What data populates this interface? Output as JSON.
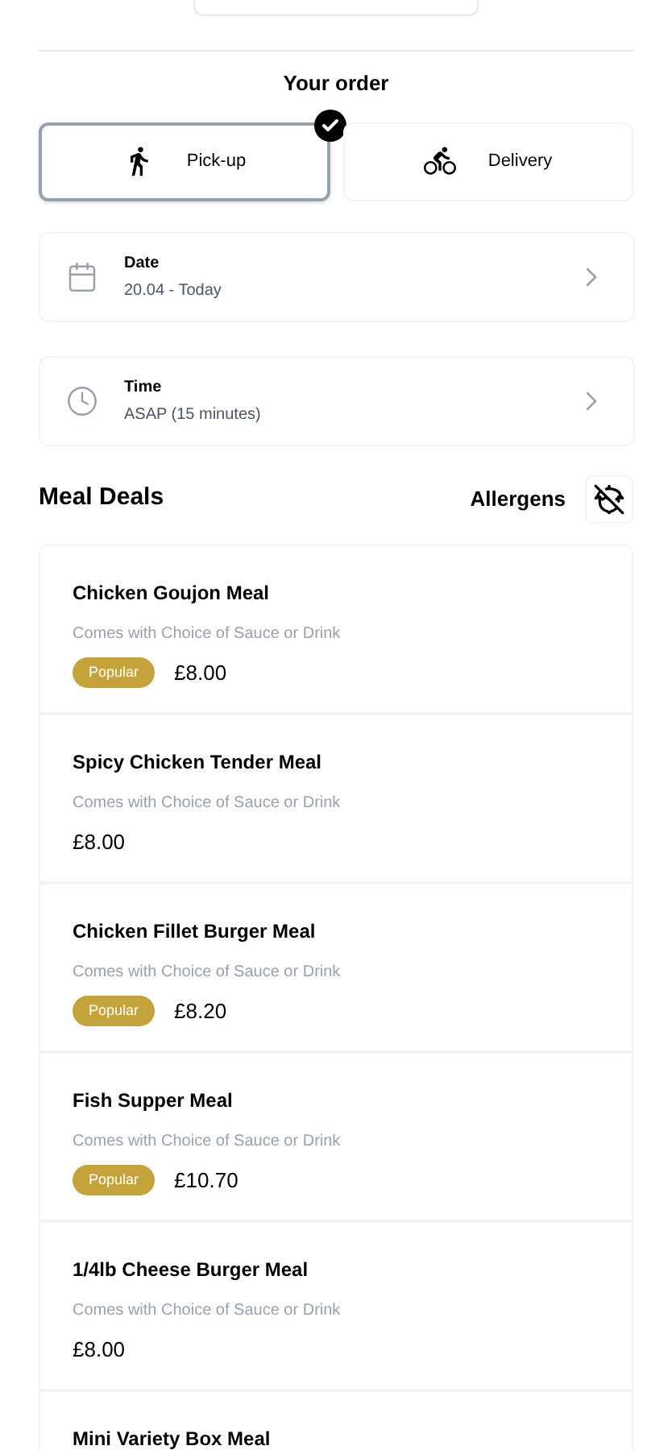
{
  "order": {
    "title": "Your order",
    "modes": [
      {
        "kind": "pickup",
        "label": "Pick-up",
        "selected": true
      },
      {
        "kind": "delivery",
        "label": "Delivery",
        "selected": false
      }
    ],
    "settings": [
      {
        "kind": "date",
        "label": "Date",
        "value": "20.04 - Today"
      },
      {
        "kind": "time",
        "label": "Time",
        "value": "ASAP (15 minutes)"
      }
    ]
  },
  "section": {
    "title": "Meal Deals",
    "allergens": "Allergens"
  },
  "items": [
    {
      "name": "Chicken Goujon Meal",
      "description": "Comes with Choice of Sauce or Drink",
      "badge": "Popular",
      "price": "£8.00"
    },
    {
      "name": "Spicy Chicken Tender Meal",
      "description": "Comes with Choice of Sauce or Drink",
      "price": "£8.00"
    },
    {
      "name": "Chicken Fillet Burger Meal",
      "description": "Comes with Choice of Sauce or Drink",
      "badge": "Popular",
      "price": "£8.20"
    },
    {
      "name": "Fish Supper Meal",
      "description": "Comes with Choice of Sauce or Drink",
      "badge": "Popular",
      "price": "£10.70"
    },
    {
      "name": "1/4lb Cheese Burger Meal",
      "description": "Comes with Choice of Sauce or Drink",
      "price": "£8.00"
    },
    {
      "name": "Mini Variety Box Meal"
    }
  ]
}
